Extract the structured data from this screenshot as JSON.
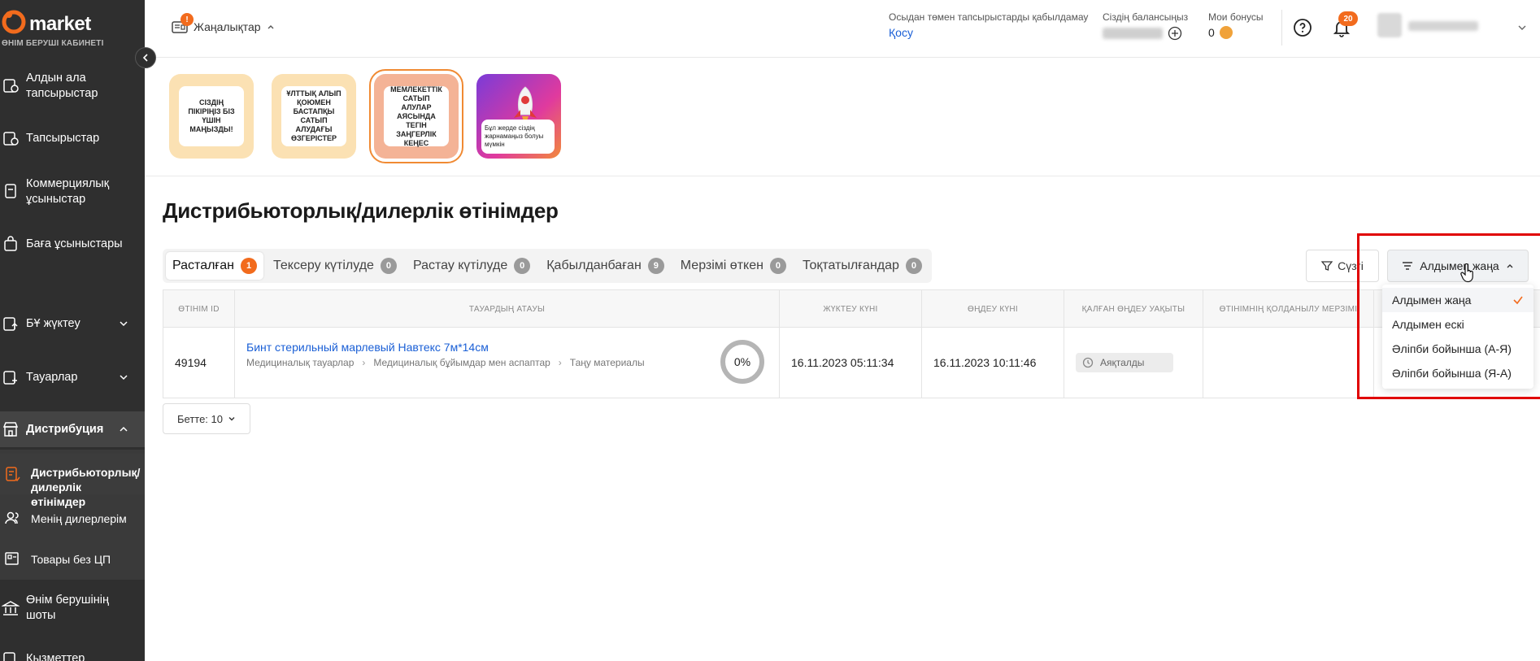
{
  "sidebar": {
    "brand": "market",
    "subtitle": "ӨНІМ БЕРУШІ КАБИНЕТІ",
    "items": [
      {
        "label": "Алдын ала тапсырыстар"
      },
      {
        "label": "Тапсырыстар"
      },
      {
        "label": "Коммерциялық ұсыныстар"
      },
      {
        "label": "Баға ұсыныстары"
      },
      {
        "label": "БҰ жүктеу"
      },
      {
        "label": "Тауарлар"
      },
      {
        "label": "Дистрибуция"
      },
      {
        "label": "Өнім берушінің шоты"
      },
      {
        "label": "Қызметтер"
      }
    ],
    "subitems": [
      {
        "label": "Дистрибьюторлық/ дилерлік өтінімдер"
      },
      {
        "label": "Менің дилерлерім"
      },
      {
        "label": "Товары без ЦП"
      }
    ]
  },
  "header": {
    "news_label": "Жаңалықтар",
    "news_badge": "!",
    "orders_text": "Осыдан төмен тапсырыстарды қабылдамау",
    "orders_link": "Қосу",
    "balance_label": "Сіздің балансыңыз",
    "bonus_label": "Мои бонусы",
    "bonus_value": "0",
    "notifications_count": "20"
  },
  "stories": [
    {
      "text": "СІЗДІҢ ПІКІРІҢІЗ БІЗ ҮШІН МАҢЫЗДЫ!"
    },
    {
      "text": "ҰЛТТЫҚ АЛЫП ҚОЮМЕН БАСТАПҚЫ САТЫП АЛУДАҒЫ ӨЗГЕРІСТЕР"
    },
    {
      "text": "МЕМЛЕКЕТТІК САТЫП АЛУЛАР АЯСЫНДА ТЕГІН ЗАҢГЕРЛІК КЕҢЕС"
    },
    {
      "text": "Бұл жерде сіздің жарнамаңыз болуы мүмкін"
    }
  ],
  "page": {
    "title": "Дистрибьюторлық/дилерлік өтінімдер"
  },
  "tabs": [
    {
      "label": "Расталған",
      "count": "1"
    },
    {
      "label": "Тексеру күтілуде",
      "count": "0"
    },
    {
      "label": "Растау күтілуде",
      "count": "0"
    },
    {
      "label": "Қабылданбаған",
      "count": "9"
    },
    {
      "label": "Мерзімі өткен",
      "count": "0"
    },
    {
      "label": "Тоқтатылғандар",
      "count": "0"
    }
  ],
  "toolbar": {
    "filter_label": "Сүзгі",
    "sort_label": "Алдымен жаңа"
  },
  "table": {
    "headers": [
      "ӨТІНІМ ID",
      "ТАУАРДЫҢ АТАУЫ",
      "ЖҮКТЕУ КҮНІ",
      "ӨҢДЕУ КҮНІ",
      "ҚАЛҒАН ӨҢДЕУ УАҚЫТЫ",
      "ӨТІНІМНІҢ ҚОЛДАНЫЛУ МЕРЗІМІ"
    ],
    "rows": [
      {
        "id": "49194",
        "product": "Бинт стерильный марлевый Навтекс 7м*14см",
        "crumbs": [
          "Медициналық тауарлар",
          "Медициналық бұйымдар мен аспаптар",
          "Таңу материалы"
        ],
        "progress": "0%",
        "uploaded": "16.11.2023 05:11:34",
        "processed": "16.11.2023 10:11:46",
        "status": "Аяқталды"
      }
    ]
  },
  "pagination": {
    "per_page_label": "Бетте: 10"
  },
  "sort_menu": {
    "options": [
      {
        "label": "Алдымен жаңа",
        "selected": true
      },
      {
        "label": "Алдымен ескі",
        "selected": false
      },
      {
        "label": "Әліпби бойынша (А-Я)",
        "selected": false
      },
      {
        "label": "Әліпби бойынша (Я-А)",
        "selected": false
      }
    ]
  },
  "colors": {
    "accent": "#f26b1d",
    "sidebar_bg": "#2f2f2f",
    "link": "#1a5fd6",
    "highlight": "#e00000"
  }
}
